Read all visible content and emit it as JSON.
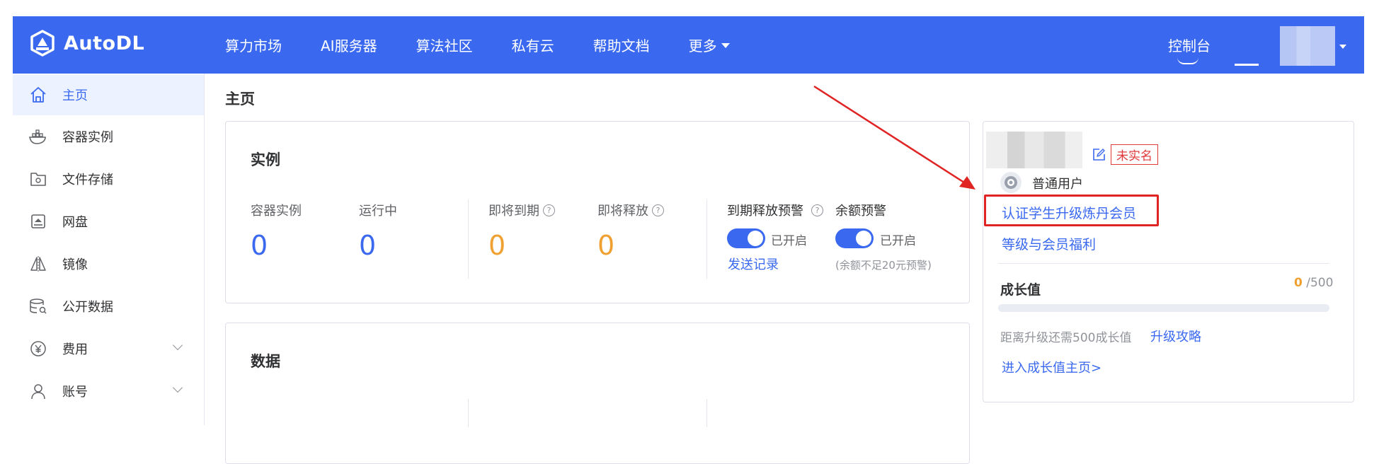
{
  "navbar": {
    "brand": "AutoDL",
    "links": [
      "算力市场",
      "AI服务器",
      "算法社区",
      "私有云",
      "帮助文档"
    ],
    "more": "更多",
    "console": "控制台"
  },
  "sidebar": {
    "items": [
      {
        "label": "主页",
        "icon": "home-icon"
      },
      {
        "label": "容器实例",
        "icon": "container-icon"
      },
      {
        "label": "文件存储",
        "icon": "folder-icon"
      },
      {
        "label": "网盘",
        "icon": "disk-icon"
      },
      {
        "label": "镜像",
        "icon": "mirror-icon"
      },
      {
        "label": "公开数据",
        "icon": "database-icon"
      },
      {
        "label": "费用",
        "icon": "yen-icon"
      },
      {
        "label": "账号",
        "icon": "user-icon"
      }
    ]
  },
  "main": {
    "page_title": "主页",
    "instances": {
      "title": "实例",
      "container_label": "容器实例",
      "container_value": "0",
      "running_label": "运行中",
      "running_value": "0",
      "expiring_label": "即将到期",
      "expiring_value": "0",
      "releasing_label": "即将释放",
      "releasing_value": "0",
      "release_alert_label": "到期释放预警",
      "balance_alert_label": "余额预警",
      "toggle_on": "已开启",
      "send_record": "发送记录",
      "balance_note": "(余额不足20元预警)"
    },
    "data": {
      "title": "数据"
    }
  },
  "profile": {
    "realname_badge": "未实名",
    "user_level": "普通用户",
    "student_link": "认证学生升级炼丹会员",
    "benefits_link": "等级与会员福利",
    "growth_label": "成长值",
    "growth_current": "0",
    "growth_total": "/500",
    "growth_progress": 0,
    "upgrade_text": "距离升级还需500成长值",
    "upgrade_link": "升级攻略",
    "growth_home_link": "进入成长值主页>"
  },
  "colors": {
    "primary": "#3a69f0",
    "warning": "#f0a030",
    "danger": "#e02424"
  }
}
